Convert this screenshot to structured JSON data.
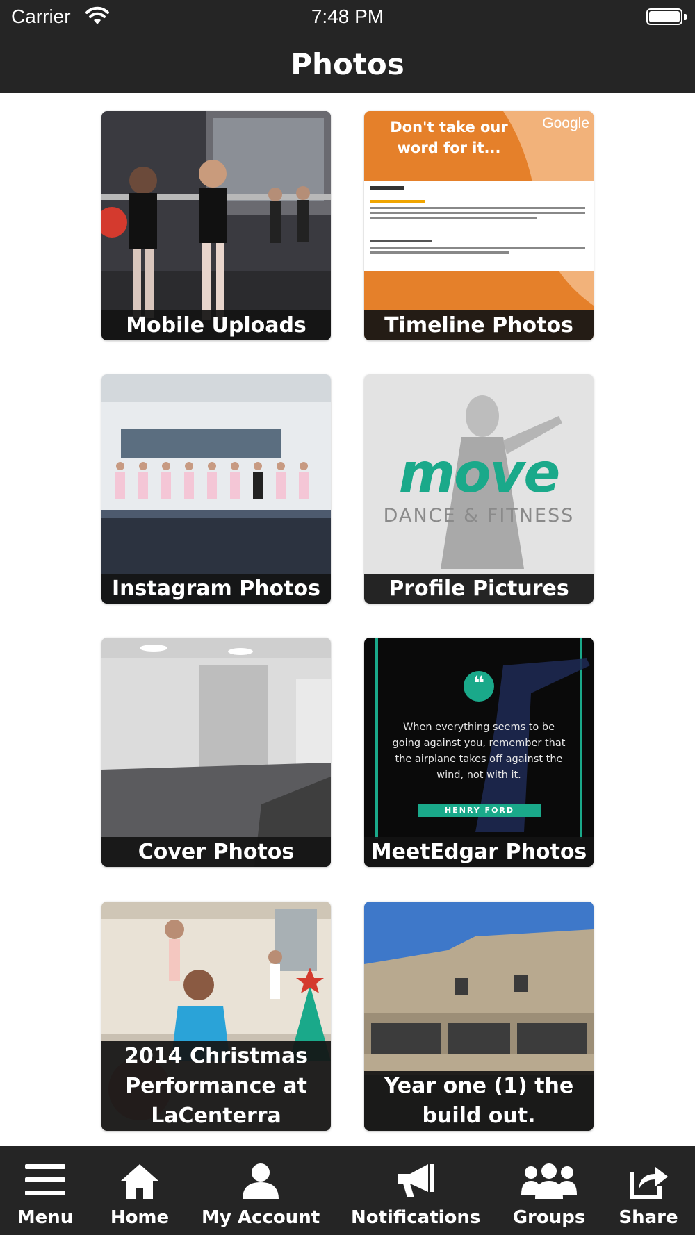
{
  "status_bar": {
    "carrier": "Carrier",
    "time": "7:48 PM"
  },
  "header": {
    "title": "Photos"
  },
  "albums": [
    {
      "name": "Mobile Uploads"
    },
    {
      "name": "Timeline Photos",
      "thumb_heading": "Don't take our word for it...",
      "thumb_brand": "Google"
    },
    {
      "name": "Instagram Photos"
    },
    {
      "name": "Profile Pictures",
      "thumb_logo": "move",
      "thumb_logo_sub": "DANCE & FITNESS"
    },
    {
      "name": "Cover Photos"
    },
    {
      "name": "MeetEdgar Photos",
      "thumb_quote": "When everything seems to be going against you, remember that the airplane takes off against the wind, not with it.",
      "thumb_author": "HENRY FORD"
    },
    {
      "name": "2014 Christmas Performance at LaCenterra"
    },
    {
      "name": "Year one (1) the build out."
    }
  ],
  "tab_bar": {
    "items": [
      {
        "label": "Menu",
        "icon": "menu-icon"
      },
      {
        "label": "Home",
        "icon": "home-icon"
      },
      {
        "label": "My Account",
        "icon": "user-icon"
      },
      {
        "label": "Notifications",
        "icon": "megaphone-icon"
      },
      {
        "label": "Groups",
        "icon": "group-icon"
      },
      {
        "label": "Share",
        "icon": "share-icon"
      }
    ]
  },
  "colors": {
    "bar": "#252525",
    "accent": "#1aa98a",
    "brand_orange": "#e5802a"
  }
}
